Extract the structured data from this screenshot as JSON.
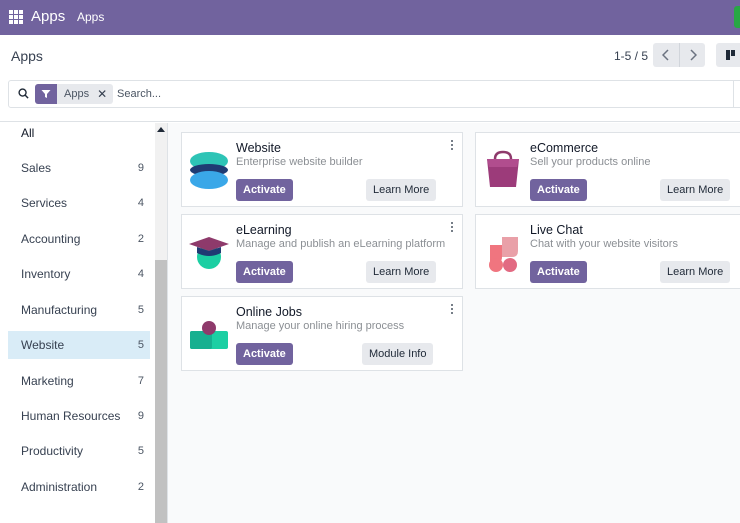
{
  "navbar": {
    "brand": "Apps",
    "menu": "Apps"
  },
  "control_panel": {
    "breadcrumb": "Apps",
    "pager": "1-5 / 5",
    "search": {
      "facet_label": "Apps",
      "placeholder": "Search..."
    }
  },
  "sidebar": {
    "items": [
      {
        "label": "All",
        "count": ""
      },
      {
        "label": "Sales",
        "count": "9"
      },
      {
        "label": "Services",
        "count": "4"
      },
      {
        "label": "Accounting",
        "count": "2"
      },
      {
        "label": "Inventory",
        "count": "4"
      },
      {
        "label": "Manufacturing",
        "count": "5"
      },
      {
        "label": "Website",
        "count": "5"
      },
      {
        "label": "Marketing",
        "count": "7"
      },
      {
        "label": "Human Resources",
        "count": "9"
      },
      {
        "label": "Productivity",
        "count": "5"
      },
      {
        "label": "Administration",
        "count": "2"
      }
    ],
    "active": "Website"
  },
  "apps": [
    {
      "name": "Website",
      "summary": "Enterprise website builder",
      "primary": "Activate",
      "secondary": "Learn More",
      "icon": "website-icon"
    },
    {
      "name": "eCommerce",
      "summary": "Sell your products online",
      "primary": "Activate",
      "secondary": "Learn More",
      "icon": "ecommerce-bag-icon"
    },
    {
      "name": "eLearning",
      "summary": "Manage and publish an eLearning platform",
      "primary": "Activate",
      "secondary": "Learn More",
      "icon": "graduation-cap-icon"
    },
    {
      "name": "Live Chat",
      "summary": "Chat with your website visitors",
      "primary": "Activate",
      "secondary": "Learn More",
      "icon": "live-chat-icon"
    },
    {
      "name": "Online Jobs",
      "summary": "Manage your online hiring process",
      "primary": "Activate",
      "secondary": "Module Info",
      "icon": "online-jobs-icon"
    }
  ],
  "colors": {
    "brand": "#71639e",
    "active_item": "#d9ecf7",
    "button_secondary": "#e7e9ed"
  }
}
